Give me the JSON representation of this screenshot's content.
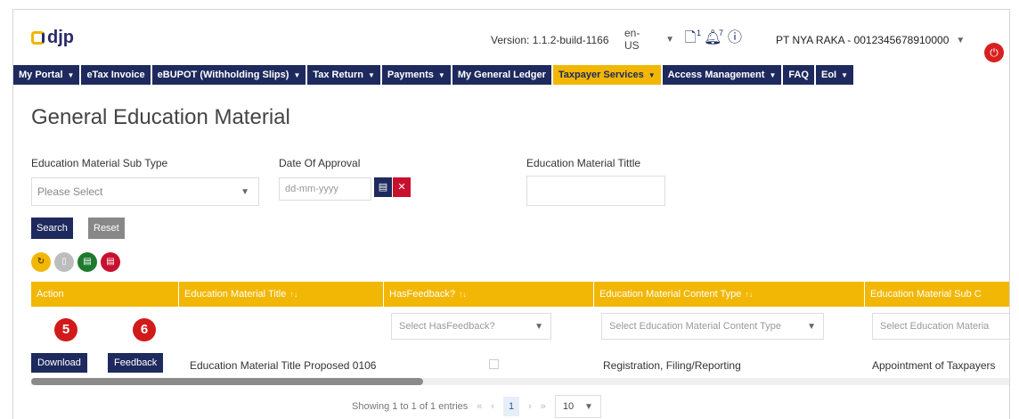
{
  "app": {
    "logo_text": "djp"
  },
  "header": {
    "version_label": "Version: 1.1.2-build-1166",
    "language": "en-US",
    "doc_badge": "1",
    "bell_badge": "7",
    "company": "PT NYA RAKA - 0012345678910000"
  },
  "menu": [
    {
      "label": "My Portal",
      "dropdown": true
    },
    {
      "label": "eTax Invoice",
      "dropdown": false
    },
    {
      "label": "eBUPOT (Withholding Slips)",
      "dropdown": true
    },
    {
      "label": "Tax Return",
      "dropdown": true
    },
    {
      "label": "Payments",
      "dropdown": true
    },
    {
      "label": "My General Ledger",
      "dropdown": false
    },
    {
      "label": "Taxpayer Services",
      "dropdown": true,
      "active": true
    },
    {
      "label": "Access Management",
      "dropdown": true
    },
    {
      "label": "FAQ",
      "dropdown": false
    },
    {
      "label": "EoI",
      "dropdown": true
    }
  ],
  "page": {
    "title": "General Education Material"
  },
  "filters": {
    "sub_type_label": "Education Material Sub Type",
    "sub_type_value": "Please Select",
    "date_label": "Date Of Approval",
    "date_placeholder": "dd-mm-yyyy",
    "title_label": "Education Material Tittle"
  },
  "buttons": {
    "search": "Search",
    "reset": "Reset"
  },
  "table": {
    "headers": [
      "Action",
      "Education Material Title",
      "HasFeedback?",
      "Education Material Content Type",
      "Education Material Sub C"
    ],
    "filter_selects": {
      "has_feedback": "Select HasFeedback?",
      "content_type": "Select Education Material Content Type",
      "sub_type": "Select Education Materia"
    },
    "badges": [
      "5",
      "6"
    ],
    "rows": [
      {
        "download": "Download",
        "feedback": "Feedback",
        "title": "Education Material Title Proposed 0106",
        "content_type": "Registration, Filing/Reporting",
        "sub_type": "Appointment of Taxpayers"
      }
    ]
  },
  "pagination": {
    "summary": "Showing 1 to 1 of 1 entries",
    "first": "«",
    "prev": "‹",
    "current": "1",
    "next": "›",
    "last": "»",
    "page_size": "10"
  }
}
